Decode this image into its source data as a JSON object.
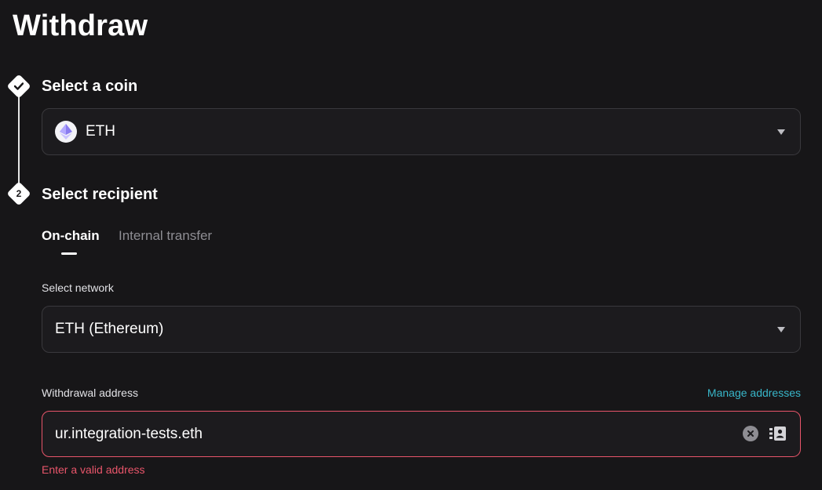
{
  "page": {
    "title": "Withdraw"
  },
  "steps": [
    {
      "title": "Select a coin",
      "marker": "check-icon"
    },
    {
      "title": "Select recipient",
      "marker": "2"
    }
  ],
  "coin_select": {
    "value": "ETH",
    "icon": "ethereum-icon"
  },
  "recipient_tabs": [
    {
      "label": "On-chain",
      "active": true
    },
    {
      "label": "Internal transfer",
      "active": false
    }
  ],
  "network": {
    "label": "Select network",
    "value": "ETH (Ethereum)"
  },
  "address": {
    "label": "Withdrawal address",
    "manage_label": "Manage addresses",
    "value": "ur.integration-tests.eth",
    "error": "Enter a valid address"
  },
  "colors": {
    "background": "#171618",
    "accent_link": "#38b6c9",
    "error": "#e8556a"
  }
}
